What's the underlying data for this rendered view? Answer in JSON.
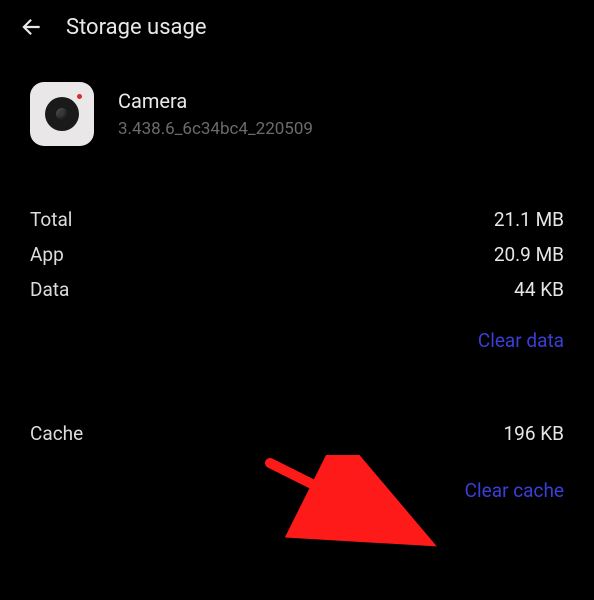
{
  "header": {
    "title": "Storage usage"
  },
  "app": {
    "name": "Camera",
    "version": "3.438.6_6c34bc4_220509"
  },
  "storage": {
    "total_label": "Total",
    "total_value": "21.1 MB",
    "app_label": "App",
    "app_value": "20.9 MB",
    "data_label": "Data",
    "data_value": "44 KB",
    "cache_label": "Cache",
    "cache_value": "196 KB"
  },
  "actions": {
    "clear_data": "Clear data",
    "clear_cache": "Clear cache"
  },
  "colors": {
    "link": "#3a3fd6",
    "annotation_arrow": "#ff1a1a"
  }
}
